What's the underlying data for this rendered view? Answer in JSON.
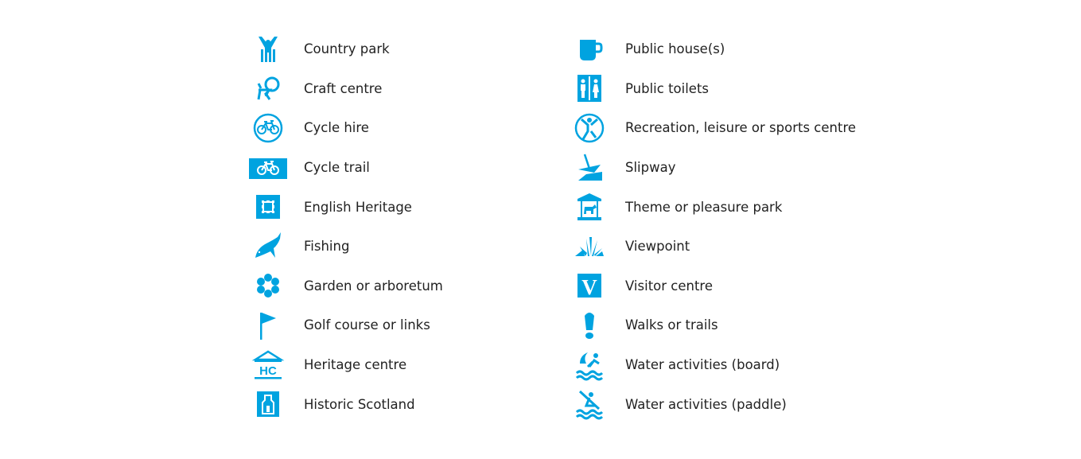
{
  "accent_color": "#00a3e0",
  "text_color": "#222222",
  "legend": {
    "left": [
      {
        "label": "Country park",
        "icon": "country-park-icon"
      },
      {
        "label": "Craft centre",
        "icon": "craft-centre-icon"
      },
      {
        "label": "Cycle hire",
        "icon": "cycle-hire-icon"
      },
      {
        "label": "Cycle trail",
        "icon": "cycle-trail-icon"
      },
      {
        "label": "English Heritage",
        "icon": "english-heritage-icon"
      },
      {
        "label": "Fishing",
        "icon": "fishing-icon"
      },
      {
        "label": "Garden or arboretum",
        "icon": "garden-icon"
      },
      {
        "label": "Golf course or links",
        "icon": "golf-flag-icon"
      },
      {
        "label": "Heritage centre",
        "icon": "heritage-centre-icon",
        "icon_text": "HC"
      },
      {
        "label": "Historic Scotland",
        "icon": "historic-scotland-icon"
      }
    ],
    "right": [
      {
        "label": "Public house(s)",
        "icon": "pub-mug-icon"
      },
      {
        "label": "Public toilets",
        "icon": "toilets-icon"
      },
      {
        "label": "Recreation, leisure or sports centre",
        "icon": "recreation-icon"
      },
      {
        "label": "Slipway",
        "icon": "slipway-icon"
      },
      {
        "label": "Theme or pleasure park",
        "icon": "carousel-icon"
      },
      {
        "label": "Viewpoint",
        "icon": "viewpoint-icon"
      },
      {
        "label": "Visitor centre",
        "icon": "visitor-centre-icon",
        "icon_text": "V"
      },
      {
        "label": "Walks or trails",
        "icon": "footprint-icon"
      },
      {
        "label": "Water activities (board)",
        "icon": "water-board-icon"
      },
      {
        "label": "Water activities (paddle)",
        "icon": "water-paddle-icon"
      }
    ]
  }
}
